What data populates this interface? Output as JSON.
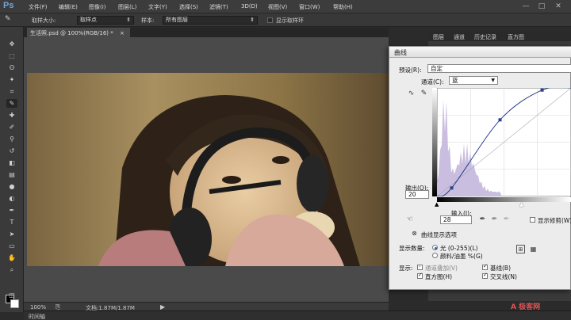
{
  "app": {
    "logo": "Ps"
  },
  "menu": [
    "文件(F)",
    "编辑(E)",
    "图像(I)",
    "图层(L)",
    "文字(Y)",
    "选择(S)",
    "滤镜(T)",
    "3D(D)",
    "视图(V)",
    "窗口(W)",
    "帮助(H)"
  ],
  "window_controls": [
    "—",
    "□",
    "✕"
  ],
  "options": {
    "sample_size_label": "取样大小:",
    "sample_size_value": "取样点",
    "sample_label": "样本:",
    "sample_value": "所有图层",
    "show_ring_label": "显示取样环"
  },
  "document": {
    "tab_title": "生活照.psd @ 100%(RGB/16) *",
    "close": "×"
  },
  "status": {
    "zoom": "100%",
    "doc_info": "文档:1.87M/1.87M"
  },
  "timeline": {
    "label": "时间轴"
  },
  "panel": {
    "tabs": [
      "图层",
      "通道",
      "历史记录",
      "直方图"
    ]
  },
  "curves": {
    "title": "曲线",
    "preset_label": "预设(R):",
    "preset_value": "自定",
    "channel_label": "通道(C):",
    "channel_value": "蓝",
    "output_label": "输出(O):",
    "output_value": "20",
    "input_label": "输入(I):",
    "input_value": "28",
    "show_clipping_label": "显示修剪(W)",
    "display_options_label": "曲线显示选项",
    "show_amount_label": "显示数量:",
    "light_option": "光 (0-255)(L)",
    "pigment_option": "颜料/油墨 %(G)",
    "show_label": "显示:",
    "channel_overlay": "通道叠加(V)",
    "baseline": "基线(B)",
    "histogram": "直方图(H)",
    "intersection": "交叉线(N)",
    "points": [
      [
        0,
        0
      ],
      [
        28,
        20
      ],
      [
        120,
        180
      ],
      [
        200,
        250
      ],
      [
        255,
        255
      ]
    ]
  },
  "watermark": "A 极客网",
  "colors": {
    "accent": "#1a5fb4",
    "histogram": "#c9bedf",
    "curve": "#2b3f8c"
  }
}
